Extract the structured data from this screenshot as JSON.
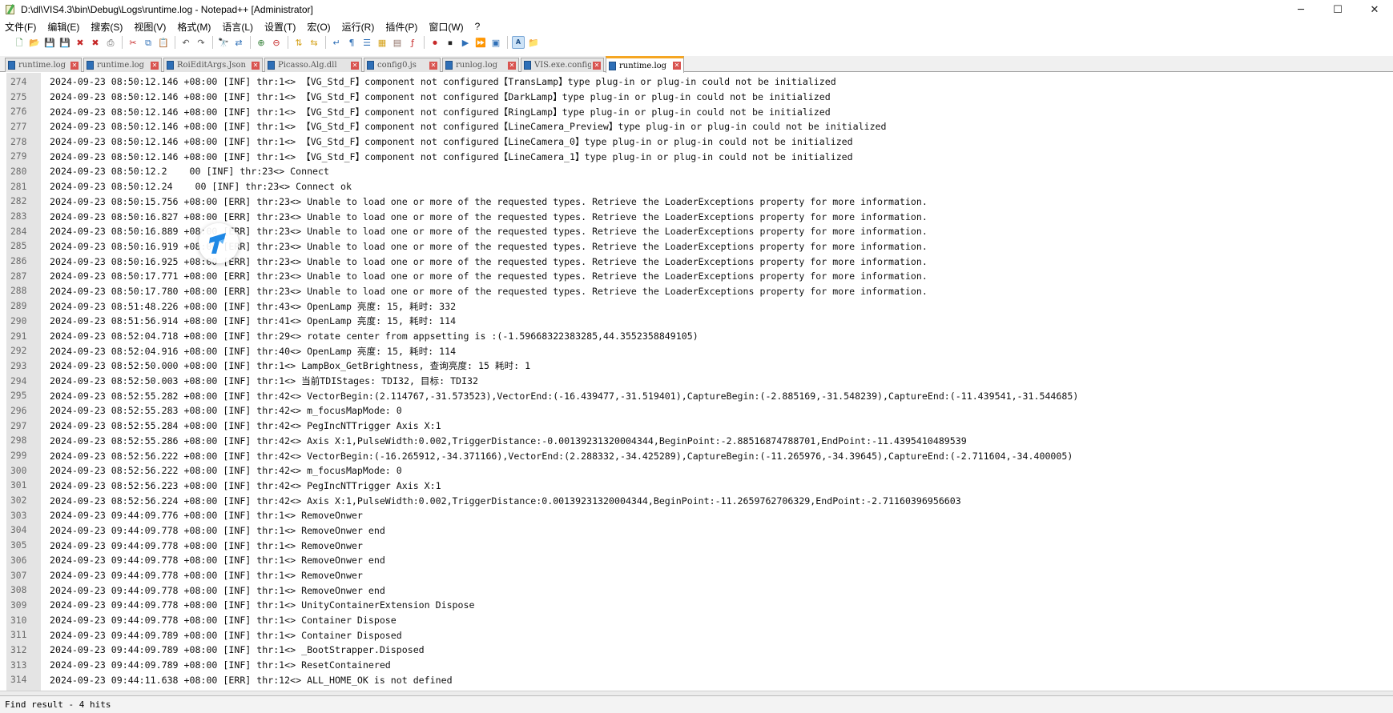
{
  "window": {
    "title": "D:\\dl\\VIS4.3\\bin\\Debug\\Logs\\runtime.log - Notepad++ [Administrator]",
    "minimize": "─",
    "maximize": "☐",
    "close": "✕"
  },
  "menu": [
    "文件(F)",
    "编辑(E)",
    "搜索(S)",
    "视图(V)",
    "格式(M)",
    "语言(L)",
    "设置(T)",
    "宏(O)",
    "运行(R)",
    "插件(P)",
    "窗口(W)",
    "?"
  ],
  "tabs": [
    "runtime.log",
    "runtime.log",
    "RoiEditArgs.Json",
    "Picasso.Alg.dll",
    "config0.js",
    "runlog.log",
    "VIS.exe.config",
    "runtime.log"
  ],
  "lines": [
    {
      "n": "274",
      "t": "2024-09-23 08:50:12.146 +08:00 [INF] thr:1<> 【VG_Std_F】component not configured【TransLamp】type plug-in or plug-in could not be initialized"
    },
    {
      "n": "275",
      "t": "2024-09-23 08:50:12.146 +08:00 [INF] thr:1<> 【VG_Std_F】component not configured【DarkLamp】type plug-in or plug-in could not be initialized"
    },
    {
      "n": "276",
      "t": "2024-09-23 08:50:12.146 +08:00 [INF] thr:1<> 【VG_Std_F】component not configured【RingLamp】type plug-in or plug-in could not be initialized"
    },
    {
      "n": "277",
      "t": "2024-09-23 08:50:12.146 +08:00 [INF] thr:1<> 【VG_Std_F】component not configured【LineCamera_Preview】type plug-in or plug-in could not be initialized"
    },
    {
      "n": "278",
      "t": "2024-09-23 08:50:12.146 +08:00 [INF] thr:1<> 【VG_Std_F】component not configured【LineCamera_0】type plug-in or plug-in could not be initialized"
    },
    {
      "n": "279",
      "t": "2024-09-23 08:50:12.146 +08:00 [INF] thr:1<> 【VG_Std_F】component not configured【LineCamera_1】type plug-in or plug-in could not be initialized"
    },
    {
      "n": "280",
      "t": "2024-09-23 08:50:12.2    00 [INF] thr:23<> Connect"
    },
    {
      "n": "281",
      "t": "2024-09-23 08:50:12.24    00 [INF] thr:23<> Connect ok"
    },
    {
      "n": "282",
      "t": "2024-09-23 08:50:15.756 +08:00 [ERR] thr:23<> Unable to load one or more of the requested types. Retrieve the LoaderExceptions property for more information."
    },
    {
      "n": "283",
      "t": "2024-09-23 08:50:16.827 +08:00 [ERR] thr:23<> Unable to load one or more of the requested types. Retrieve the LoaderExceptions property for more information."
    },
    {
      "n": "284",
      "t": "2024-09-23 08:50:16.889 +08:00 [ERR] thr:23<> Unable to load one or more of the requested types. Retrieve the LoaderExceptions property for more information."
    },
    {
      "n": "285",
      "t": "2024-09-23 08:50:16.919 +08:00 [ERR] thr:23<> Unable to load one or more of the requested types. Retrieve the LoaderExceptions property for more information."
    },
    {
      "n": "286",
      "t": "2024-09-23 08:50:16.925 +08:00 [ERR] thr:23<> Unable to load one or more of the requested types. Retrieve the LoaderExceptions property for more information."
    },
    {
      "n": "287",
      "t": "2024-09-23 08:50:17.771 +08:00 [ERR] thr:23<> Unable to load one or more of the requested types. Retrieve the LoaderExceptions property for more information."
    },
    {
      "n": "288",
      "t": "2024-09-23 08:50:17.780 +08:00 [ERR] thr:23<> Unable to load one or more of the requested types. Retrieve the LoaderExceptions property for more information."
    },
    {
      "n": "289",
      "t": "2024-09-23 08:51:48.226 +08:00 [INF] thr:43<> OpenLamp 亮度: 15, 耗时: 332"
    },
    {
      "n": "290",
      "t": "2024-09-23 08:51:56.914 +08:00 [INF] thr:41<> OpenLamp 亮度: 15, 耗时: 114"
    },
    {
      "n": "291",
      "t": "2024-09-23 08:52:04.718 +08:00 [INF] thr:29<> rotate center from appsetting is :(-1.59668322383285,44.3552358849105)"
    },
    {
      "n": "292",
      "t": "2024-09-23 08:52:04.916 +08:00 [INF] thr:40<> OpenLamp 亮度: 15, 耗时: 114"
    },
    {
      "n": "293",
      "t": "2024-09-23 08:52:50.000 +08:00 [INF] thr:1<> LampBox_GetBrightness, 查询亮度: 15 耗时: 1"
    },
    {
      "n": "294",
      "t": "2024-09-23 08:52:50.003 +08:00 [INF] thr:1<> 当前TDIStages: TDI32, 目标: TDI32"
    },
    {
      "n": "295",
      "t": "2024-09-23 08:52:55.282 +08:00 [INF] thr:42<> VectorBegin:(2.114767,-31.573523),VectorEnd:(-16.439477,-31.519401),CaptureBegin:(-2.885169,-31.548239),CaptureEnd:(-11.439541,-31.544685)"
    },
    {
      "n": "296",
      "t": "2024-09-23 08:52:55.283 +08:00 [INF] thr:42<> m_focusMapMode: 0"
    },
    {
      "n": "297",
      "t": "2024-09-23 08:52:55.284 +08:00 [INF] thr:42<> PegIncNTTrigger Axis X:1"
    },
    {
      "n": "298",
      "t": "2024-09-23 08:52:55.286 +08:00 [INF] thr:42<> Axis X:1,PulseWidth:0.002,TriggerDistance:-0.00139231320004344,BeginPoint:-2.88516874788701,EndPoint:-11.4395410489539"
    },
    {
      "n": "299",
      "t": "2024-09-23 08:52:56.222 +08:00 [INF] thr:42<> VectorBegin:(-16.265912,-34.371166),VectorEnd:(2.288332,-34.425289),CaptureBegin:(-11.265976,-34.39645),CaptureEnd:(-2.711604,-34.400005)"
    },
    {
      "n": "300",
      "t": "2024-09-23 08:52:56.222 +08:00 [INF] thr:42<> m_focusMapMode: 0"
    },
    {
      "n": "301",
      "t": "2024-09-23 08:52:56.223 +08:00 [INF] thr:42<> PegIncNTTrigger Axis X:1"
    },
    {
      "n": "302",
      "t": "2024-09-23 08:52:56.224 +08:00 [INF] thr:42<> Axis X:1,PulseWidth:0.002,TriggerDistance:0.00139231320004344,BeginPoint:-11.2659762706329,EndPoint:-2.71160396956603"
    },
    {
      "n": "303",
      "t": "2024-09-23 09:44:09.776 +08:00 [INF] thr:1<> RemoveOnwer"
    },
    {
      "n": "304",
      "t": "2024-09-23 09:44:09.778 +08:00 [INF] thr:1<> RemoveOnwer end"
    },
    {
      "n": "305",
      "t": "2024-09-23 09:44:09.778 +08:00 [INF] thr:1<> RemoveOnwer"
    },
    {
      "n": "306",
      "t": "2024-09-23 09:44:09.778 +08:00 [INF] thr:1<> RemoveOnwer end"
    },
    {
      "n": "307",
      "t": "2024-09-23 09:44:09.778 +08:00 [INF] thr:1<> RemoveOnwer"
    },
    {
      "n": "308",
      "t": "2024-09-23 09:44:09.778 +08:00 [INF] thr:1<> RemoveOnwer end"
    },
    {
      "n": "309",
      "t": "2024-09-23 09:44:09.778 +08:00 [INF] thr:1<> UnityContainerExtension Dispose"
    },
    {
      "n": "310",
      "t": "2024-09-23 09:44:09.778 +08:00 [INF] thr:1<> Container Dispose"
    },
    {
      "n": "311",
      "t": "2024-09-23 09:44:09.789 +08:00 [INF] thr:1<> Container Disposed"
    },
    {
      "n": "312",
      "t": "2024-09-23 09:44:09.789 +08:00 [INF] thr:1<> _BootStrapper.Disposed"
    },
    {
      "n": "313",
      "t": "2024-09-23 09:44:09.789 +08:00 [INF] thr:1<> ResetContainered"
    },
    {
      "n": "314",
      "t": "2024-09-23 09:44:11.638 +08:00 [ERR] thr:12<> ALL_HOME_OK is not defined"
    }
  ],
  "status": "Find result - 4 hits",
  "colors": {
    "gutter_bg": "#e4e4e4",
    "active_tab_accent": "#f5a623",
    "tab_icon": "#2e6fb7",
    "tab_close": "#d9534f"
  }
}
